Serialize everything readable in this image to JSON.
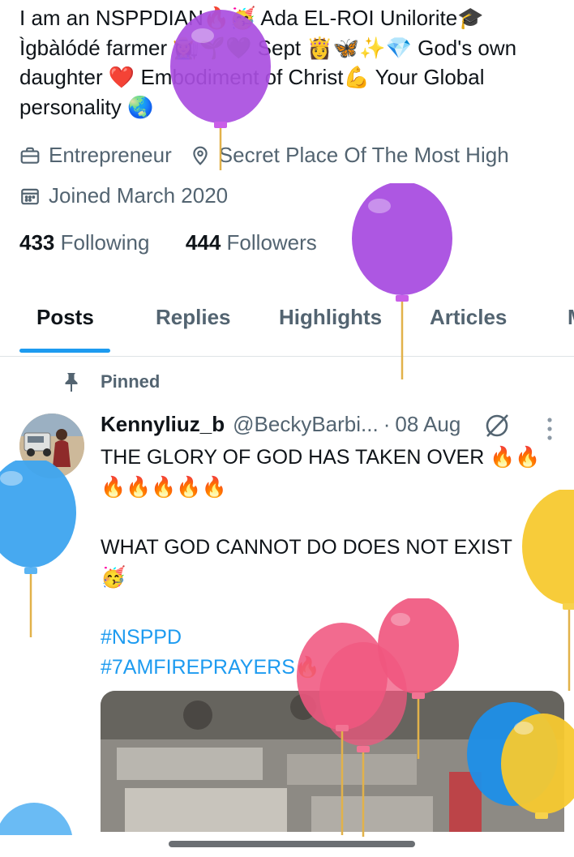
{
  "profile": {
    "bio_lines": [
      "I am an NSPPDIAN🔥🥳 Ada EL-ROI Unilorite🎓",
      "Ìgbàlódé farmer 👩‍🌾🌱💚 Sept 👸🦋✨💎 God's own",
      "daughter ❤️ Embodiment of Christ💪 Your Global",
      "personality 🌏"
    ],
    "profession": "Entrepreneur",
    "location": "Secret Place Of The Most High",
    "joined": "Joined March 2020",
    "following_count": "433",
    "following_label": "Following",
    "followers_count": "444",
    "followers_label": "Followers"
  },
  "tabs": [
    {
      "label": "Posts",
      "active": true
    },
    {
      "label": "Replies",
      "active": false
    },
    {
      "label": "Highlights",
      "active": false
    },
    {
      "label": "Articles",
      "active": false
    },
    {
      "label": "M",
      "active": false
    }
  ],
  "pinned_label": "Pinned",
  "tweet": {
    "name": "Kennyliuz_b",
    "handle": "@BeckyBarbi...",
    "separator": "·",
    "date": "08 Aug",
    "lines": [
      "THE GLORY OF GOD HAS TAKEN OVER 🔥🔥",
      "🔥🔥🔥🔥🔥",
      "",
      "WHAT GOD CANNOT DO DOES NOT EXIST",
      "🥳"
    ],
    "hashtags": [
      "#NSPPD",
      "#7AMFIREPRAYERS🔥"
    ]
  },
  "colors": {
    "accent": "#1d9bf0",
    "text": "#0f1419",
    "muted": "#536471",
    "balloon_purple": "#a94ee0",
    "balloon_blue": "#3da4ef",
    "balloon_pink": "#f0577f",
    "balloon_yellow": "#f7c92f"
  },
  "icons": {
    "profession": "briefcase-icon",
    "location": "location-pin-icon",
    "joined": "calendar-icon",
    "pinned": "pin-icon",
    "grok": "grok-icon",
    "more": "more-vertical-icon"
  }
}
